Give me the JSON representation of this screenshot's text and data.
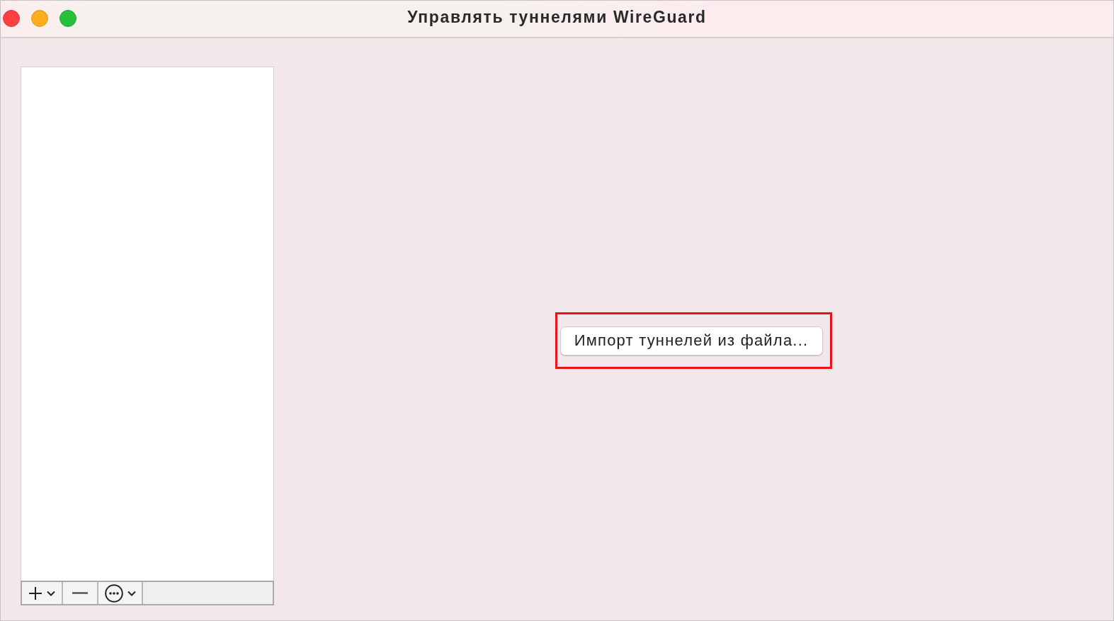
{
  "window": {
    "title": "Управлять туннелями WireGuard"
  },
  "import_button": {
    "label": "Импорт туннелей из файла...",
    "highlighted": true
  }
}
